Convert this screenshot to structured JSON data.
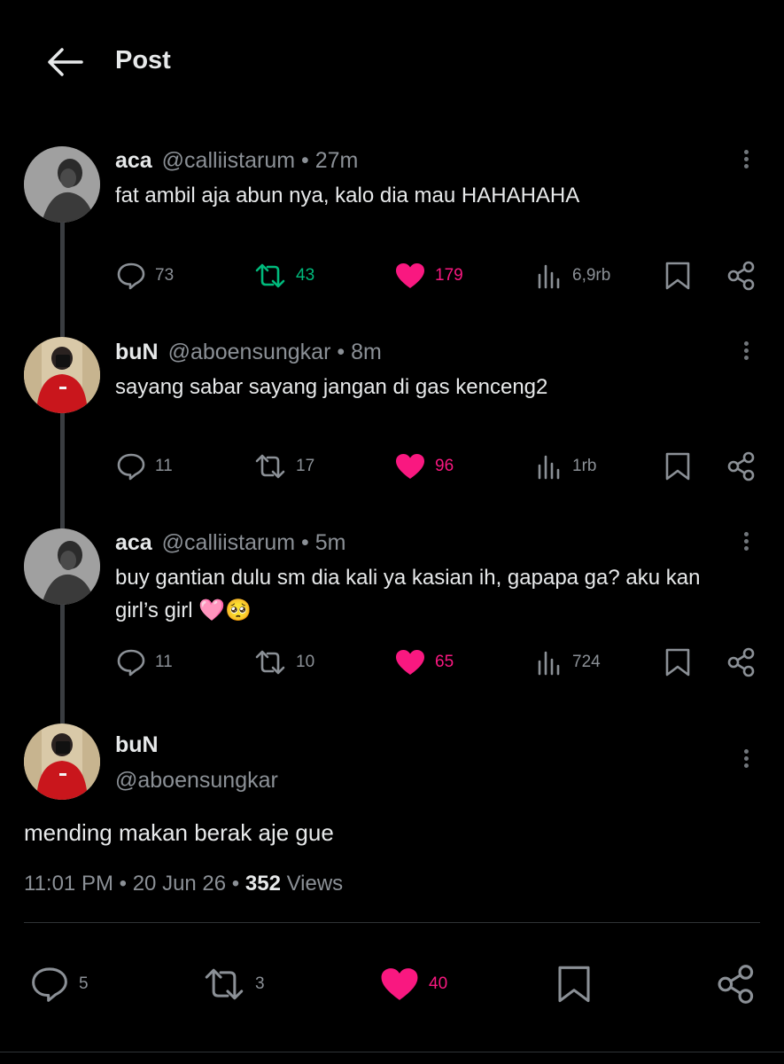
{
  "header": {
    "title": "Post"
  },
  "thread": [
    {
      "name": "aca",
      "handle": "@calliistarum",
      "sep": " • ",
      "time": "27m",
      "text": "fat ambil aja abun nya, kalo dia mau HAHAHAHA",
      "replies": "73",
      "reposts": "43",
      "likes": "179",
      "views": "6,9rb",
      "reposted": true
    },
    {
      "name": "buN",
      "handle": "@aboensungkar",
      "sep": " • ",
      "time": "8m",
      "text": "sayang sabar sayang jangan di gas kenceng2",
      "replies": "11",
      "reposts": "17",
      "likes": "96",
      "views": "1rb",
      "reposted": false
    },
    {
      "name": "aca",
      "handle": "@calliistarum",
      "sep": " • ",
      "time": "5m",
      "text": "buy gantian dulu sm dia kali ya kasian ih, gapapa ga? aku kan girl’s girl 🩷🥺",
      "replies": "11",
      "reposts": "10",
      "likes": "65",
      "views": "724",
      "reposted": false
    }
  ],
  "main": {
    "name": "buN",
    "handle": "@aboensungkar",
    "text": "mending makan berak aje gue",
    "time": "11:01 PM",
    "sep": " • ",
    "date": "20 Jun 26",
    "views_count": "352",
    "views_label": "Views",
    "replies": "5",
    "reposts": "3",
    "likes": "40"
  },
  "colors": {
    "background": "#000000",
    "muted": "#8b9096",
    "repost_active": "#00ba7c",
    "like_active": "#f91880"
  }
}
